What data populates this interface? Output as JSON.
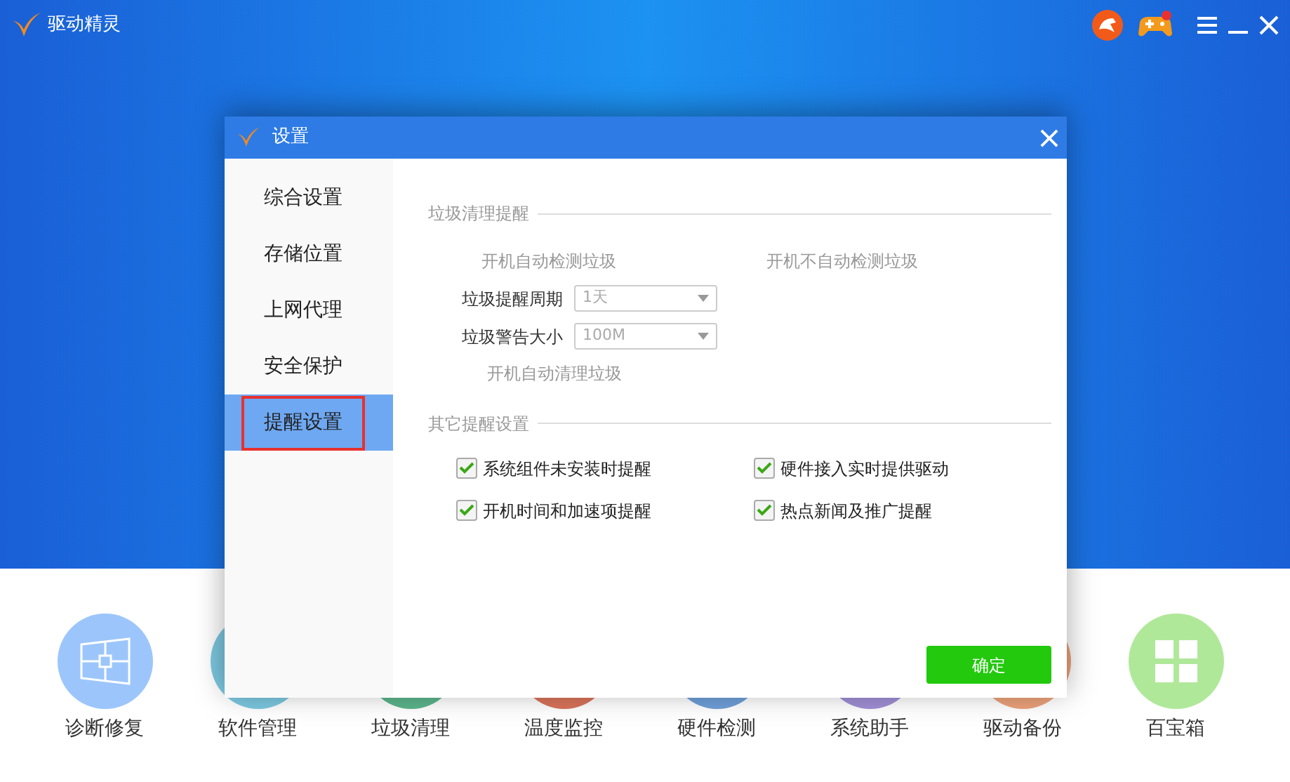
{
  "app": {
    "title": "驱动精灵"
  },
  "tools": [
    {
      "label": "诊断修复",
      "color": "#9cc6fb"
    },
    {
      "label": "软件管理",
      "color": "#7cc7e0"
    },
    {
      "label": "垃圾清理",
      "color": "#5bb58c"
    },
    {
      "label": "温度监控",
      "color": "#d9735a"
    },
    {
      "label": "硬件检测",
      "color": "#6f9fd8"
    },
    {
      "label": "系统助手",
      "color": "#a08fd6"
    },
    {
      "label": "驱动备份",
      "color": "#eca27a"
    },
    {
      "label": "百宝箱",
      "color": "#b0e89a"
    }
  ],
  "dialog": {
    "title": "设置",
    "sidebar": [
      {
        "label": "综合设置",
        "selected": false
      },
      {
        "label": "存储位置",
        "selected": false
      },
      {
        "label": "上网代理",
        "selected": false
      },
      {
        "label": "安全保护",
        "selected": false
      },
      {
        "label": "提醒设置",
        "selected": true
      }
    ],
    "trash_section": {
      "title": "垃圾清理提醒",
      "disabled": true,
      "options": [
        "开机自动检测垃圾",
        "开机不自动检测垃圾"
      ],
      "dropdowns": [
        {
          "label": "垃圾提醒周期",
          "value": "1天"
        },
        {
          "label": "垃圾警告大小",
          "value": "100M"
        }
      ],
      "auto_clean": "开机自动清理垃圾"
    },
    "other_section": {
      "title": "其它提醒设置",
      "checkboxes": [
        {
          "label": "系统组件未安装时提醒",
          "checked": true
        },
        {
          "label": "硬件接入实时提供驱动",
          "checked": true
        },
        {
          "label": "开机时间和加速项提醒",
          "checked": true
        },
        {
          "label": "热点新闻及推广提醒",
          "checked": true
        }
      ]
    },
    "ok_button": "确定"
  }
}
